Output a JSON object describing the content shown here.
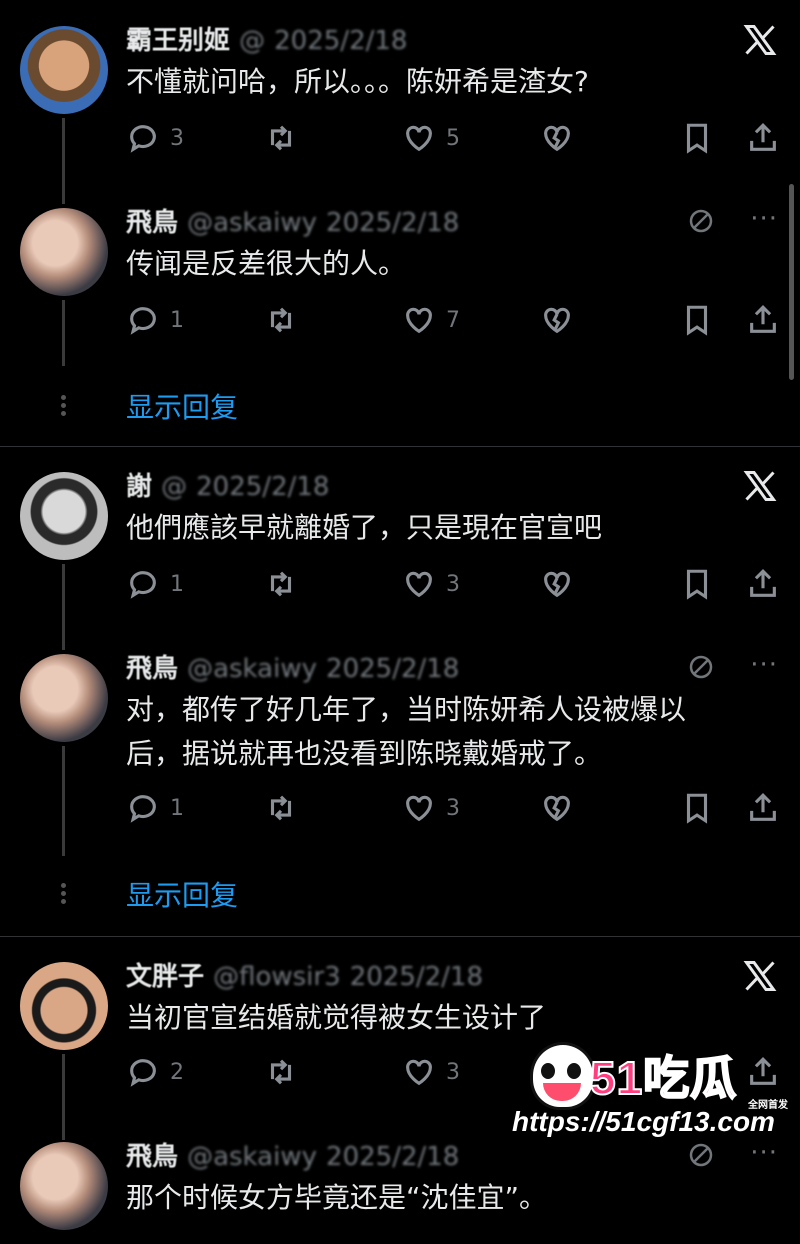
{
  "tweets": [
    {
      "name": "霸王别姬",
      "handle": "@",
      "date": "2025/2/18",
      "text": "不懂就问哈，所以。。。陈妍希是渣女?",
      "replies": "3",
      "retweets": "",
      "likes": "5"
    },
    {
      "name": "飛鳥",
      "handle": "@askaiwy",
      "date": "2025/2/18",
      "text": "传闻是反差很大的人。",
      "replies": "1",
      "retweets": "",
      "likes": "7"
    },
    {
      "name": "謝",
      "handle": "@",
      "date": "2025/2/18",
      "text": "他們應該早就離婚了，只是現在官宣吧",
      "replies": "1",
      "retweets": "",
      "likes": "3"
    },
    {
      "name": "飛鳥",
      "handle": "@askaiwy",
      "date": "2025/2/18",
      "text_line1": "对，都传了好几年了，当时陈妍希人设被爆以",
      "text_line2": "后，据说就再也没看到陈晓戴婚戒了。",
      "replies": "1",
      "retweets": "",
      "likes": "3"
    },
    {
      "name": "文胖子",
      "handle": "@flowsir3",
      "date": "2025/2/18",
      "text": "当初官宣结婚就觉得被女生设计了",
      "replies": "2",
      "retweets": "",
      "likes": "3"
    },
    {
      "name": "飛鳥",
      "handle": "@askaiwy",
      "date": "2025/2/18",
      "text": "那个时候女方毕竟还是“沈佳宜”。"
    }
  ],
  "show_replies_label": "显示回复",
  "watermark": {
    "brand": "51吃瓜",
    "tag": "全网首发",
    "url": "https://51cgf13.com"
  },
  "icons": {
    "reply": "reply-icon",
    "retweet": "retweet-icon",
    "like": "heart-icon",
    "dislike": "broken-heart-icon",
    "bookmark": "bookmark-icon",
    "share": "share-icon",
    "x": "x-logo-icon",
    "more": "more-icon"
  },
  "colors": {
    "background": "#000000",
    "text": "#e7e9ea",
    "muted": "#71767b",
    "link": "#1d9bf0",
    "watermark_pink": "#ff3d7f"
  }
}
